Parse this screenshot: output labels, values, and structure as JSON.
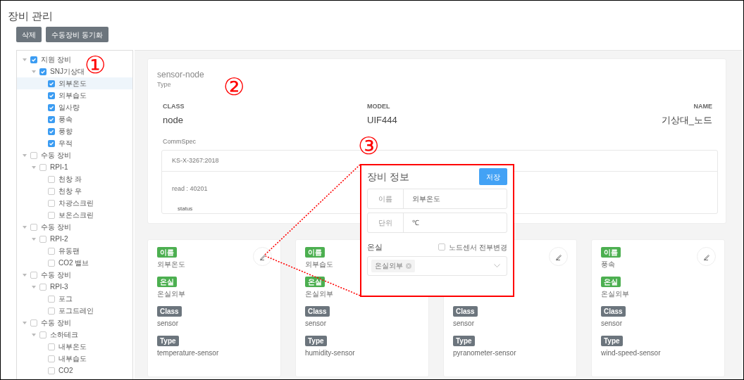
{
  "page_title": "장비 관리",
  "toolbar": [
    "삭제",
    "수동장비 동기화"
  ],
  "tree": [
    {
      "label": "지원 장비",
      "checked": true,
      "expanded": true,
      "selected": false,
      "children": [
        {
          "label": "SNJ기상대",
          "checked": true,
          "expanded": true,
          "selected": false,
          "children": [
            {
              "label": "외부온도",
              "checked": true,
              "selected": true
            },
            {
              "label": "외부습도",
              "checked": true,
              "selected": false
            },
            {
              "label": "일사량",
              "checked": true,
              "selected": false
            },
            {
              "label": "풍속",
              "checked": true,
              "selected": false
            },
            {
              "label": "풍향",
              "checked": true,
              "selected": false
            },
            {
              "label": "우적",
              "checked": true,
              "selected": false
            }
          ]
        }
      ]
    },
    {
      "label": "수동 장비",
      "checked": false,
      "expanded": true,
      "selected": false,
      "children": [
        {
          "label": "RPI-1",
          "checked": false,
          "expanded": true,
          "selected": false,
          "children": [
            {
              "label": "천창 좌",
              "checked": false,
              "selected": false
            },
            {
              "label": "천창 우",
              "checked": false,
              "selected": false
            },
            {
              "label": "차광스크린",
              "checked": false,
              "selected": false
            },
            {
              "label": "보온스크린",
              "checked": false,
              "selected": false
            }
          ]
        }
      ]
    },
    {
      "label": "수동 장비",
      "checked": false,
      "expanded": true,
      "selected": false,
      "children": [
        {
          "label": "RPI-2",
          "checked": false,
          "expanded": true,
          "selected": false,
          "children": [
            {
              "label": "유동팬",
              "checked": false,
              "selected": false
            },
            {
              "label": "CO2 밸브",
              "checked": false,
              "selected": false
            }
          ]
        }
      ]
    },
    {
      "label": "수동 장비",
      "checked": false,
      "expanded": true,
      "selected": false,
      "children": [
        {
          "label": "RPI-3",
          "checked": false,
          "expanded": true,
          "selected": false,
          "children": [
            {
              "label": "포그",
              "checked": false,
              "selected": false
            },
            {
              "label": "포그드레인",
              "checked": false,
              "selected": false
            }
          ]
        }
      ]
    },
    {
      "label": "수동 장비",
      "checked": false,
      "expanded": true,
      "selected": false,
      "children": [
        {
          "label": "소하테크",
          "checked": false,
          "expanded": true,
          "selected": false,
          "children": [
            {
              "label": "내부온도",
              "checked": false,
              "selected": false
            },
            {
              "label": "내부습도",
              "checked": false,
              "selected": false
            },
            {
              "label": "CO2",
              "checked": false,
              "selected": false
            }
          ]
        }
      ]
    }
  ],
  "node_info": {
    "name": "sensor-node",
    "name_caption": "Type",
    "columns": [
      {
        "label": "CLASS",
        "value": "node"
      },
      {
        "label": "MODEL",
        "value": "UIF444"
      },
      {
        "label": "NAME",
        "value": "기상대_노드"
      }
    ],
    "comm_spec_label": "CommSpec",
    "comm_spec": {
      "standard": "KS-X-3267:2018",
      "read": "read : 40201",
      "detail": "status"
    }
  },
  "sensor_cards": [
    {
      "edit_button": true,
      "fields": [
        {
          "label": "이름",
          "value": "외부온도",
          "color": "#4caf50"
        },
        {
          "label": "온실",
          "value": "온실외부",
          "color": "#4caf50"
        },
        {
          "label": "Class",
          "value": "sensor",
          "color": "#6c757d"
        },
        {
          "label": "Type",
          "value": "temperature-sensor",
          "color": "#6c757d"
        }
      ]
    },
    {
      "fields": [
        {
          "label": "이름",
          "value": "외부습도",
          "color": "#4caf50"
        },
        {
          "label": "온실",
          "value": "온실외부",
          "color": "#4caf50"
        },
        {
          "label": "Class",
          "value": "sensor",
          "color": "#6c757d"
        },
        {
          "label": "Type",
          "value": "humidity-sensor",
          "color": "#6c757d"
        }
      ]
    },
    {
      "edit_button": true,
      "fields": [
        {
          "label": "Class",
          "value": "sensor",
          "color": "#6c757d"
        },
        {
          "label": "Type",
          "value": "pyranometer-sensor",
          "color": "#6c757d"
        }
      ]
    },
    {
      "edit_button": true,
      "fields": [
        {
          "label": "이름",
          "value": "풍속",
          "color": "#4caf50"
        },
        {
          "label": "온실",
          "value": "온실외부",
          "color": "#4caf50"
        },
        {
          "label": "Class",
          "value": "sensor",
          "color": "#6c757d"
        },
        {
          "label": "Type",
          "value": "wind-speed-sensor",
          "color": "#6c757d"
        }
      ]
    }
  ],
  "edit_popup": {
    "title": "장비 정보",
    "save": "저장",
    "fields": [
      {
        "label": "이름",
        "value": "외부온도"
      },
      {
        "label": "단위",
        "value": "℃"
      }
    ],
    "greenhouse_label": "온실",
    "apply_all": {
      "label": "노드센서 전부변경",
      "checked": false
    },
    "greenhouse_tags": [
      "온실외부"
    ]
  },
  "markers": [
    "①",
    "②",
    "③"
  ]
}
